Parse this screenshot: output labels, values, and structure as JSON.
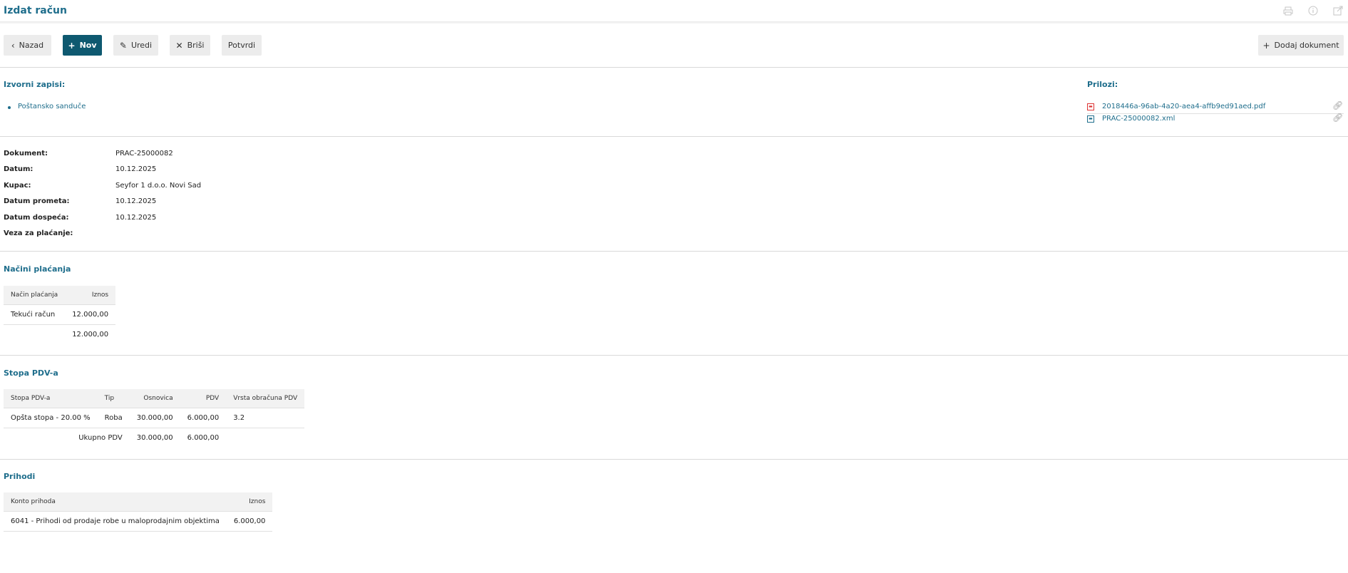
{
  "header": {
    "title": "Izdat račun"
  },
  "toolbar": {
    "back_label": "Nazad",
    "new_label": "Nov",
    "edit_label": "Uredi",
    "delete_label": "Briši",
    "confirm_label": "Potvrdi",
    "add_document_label": "Dodaj dokument"
  },
  "sources": {
    "heading": "Izvorni zapisi:",
    "items": [
      "Poštansko sanduče"
    ]
  },
  "attachments": {
    "heading": "Prilozi:",
    "files": [
      {
        "name": "2018446a-96ab-4a20-aea4-affb9ed91aed.pdf",
        "icon": "pdf-file-icon"
      },
      {
        "name": "PRAC-25000082.xml",
        "icon": "xml-file-icon"
      }
    ]
  },
  "details": {
    "document_label": "Dokument:",
    "document_value": "PRAC-25000082",
    "date_label": "Datum:",
    "date_value": "10.12.2025",
    "customer_label": "Kupac:",
    "customer_value": "Seyfor 1 d.o.o. Novi Sad",
    "turnover_date_label": "Datum prometa:",
    "turnover_date_value": "10.12.2025",
    "due_date_label": "Datum dospeća:",
    "due_date_value": "10.12.2025",
    "payment_ref_label": "Veza za plaćanje:",
    "payment_ref_value": ""
  },
  "payments": {
    "heading": "Načini plaćanja",
    "columns": [
      "Način plaćanja",
      "Iznos"
    ],
    "rows": [
      {
        "method": "Tekući račun",
        "amount": "12.000,00"
      }
    ],
    "total": "12.000,00"
  },
  "vat": {
    "heading": "Stopa PDV-a",
    "columns": [
      "Stopa PDV-a",
      "Tip",
      "Osnovica",
      "PDV",
      "Vrsta obračuna PDV"
    ],
    "rows": [
      {
        "rate": "Opšta stopa - 20.00 %",
        "type": "Roba",
        "base": "30.000,00",
        "vat": "6.000,00",
        "kind": "3.2"
      }
    ],
    "total_label": "Ukupno PDV",
    "total_base": "30.000,00",
    "total_vat": "6.000,00"
  },
  "revenue": {
    "heading": "Prihodi",
    "columns": [
      "Konto prihoda",
      "Iznos"
    ],
    "rows": [
      {
        "account": "6041 - Prihodi od prodaje robe u maloprodajnim objektima",
        "amount": "6.000,00"
      }
    ]
  },
  "colors": {
    "accent": "#1f6e8c",
    "primary_button": "#0e5970"
  }
}
